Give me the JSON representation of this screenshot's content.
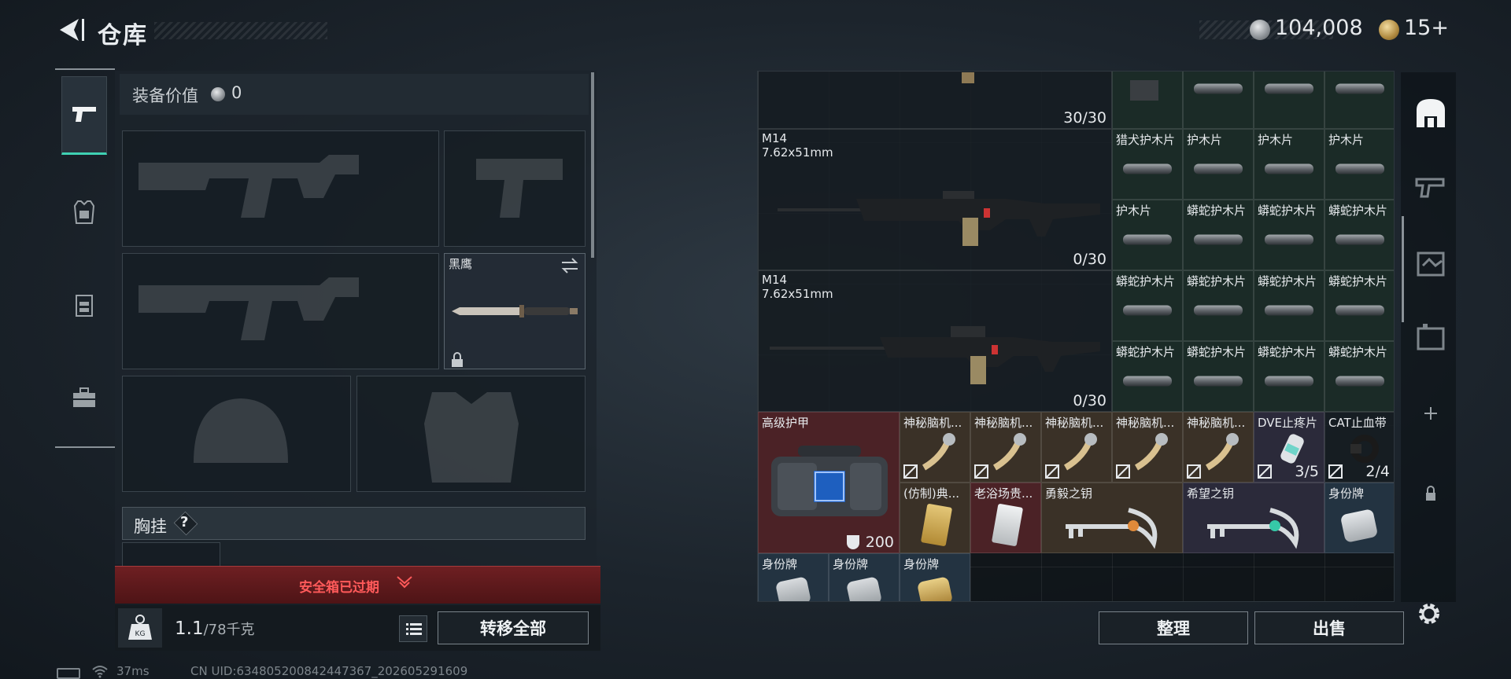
{
  "header": {
    "title": "仓库",
    "currency": "104,008",
    "tickets": "15+"
  },
  "left_tabs": [
    {
      "name": "weapons",
      "icon": "pistol-icon",
      "active": true
    },
    {
      "name": "armor",
      "icon": "armor-icon",
      "active": false
    },
    {
      "name": "rig",
      "icon": "chest-rig-icon",
      "active": false
    },
    {
      "name": "case",
      "icon": "toolbox-icon",
      "active": false
    }
  ],
  "equipment": {
    "value_label": "装备价值",
    "value": "0",
    "melee_name": "黑鹰",
    "chest_label": "胸挂",
    "chest_help": "?",
    "safebox_status": "安全箱已过期",
    "weight_current": "1.1",
    "weight_capacity": "/78千克",
    "transfer_all": "转移全部"
  },
  "status": {
    "ping": "37ms",
    "uid": "CN UID:6348052008424473​67_202605291609"
  },
  "stash": {
    "top_count": "30/30",
    "rifle1": {
      "name": "M14",
      "caliber": "7.62x51mm",
      "ammo": "0/30"
    },
    "rifle2": {
      "name": "M14",
      "caliber": "7.62x51mm",
      "ammo": "0/30"
    },
    "handguards": {
      "r1": [
        "猎犬护木片",
        "护木片",
        "护木片",
        "护木片"
      ],
      "r2": [
        "护木片",
        "蟒蛇护木片",
        "蟒蛇护木片",
        "蟒蛇护木片"
      ],
      "r3": [
        "蟒蛇护木片",
        "蟒蛇护木片",
        "蟒蛇护木片",
        "蟒蛇护木片"
      ],
      "r4": [
        "蟒蛇护木片",
        "蟒蛇护木片",
        "蟒蛇护木片",
        "蟒蛇护木片"
      ]
    },
    "armor": {
      "name": "高级护甲",
      "durability": "200"
    },
    "implants": [
      "神秘脑机...",
      "神秘脑机...",
      "神秘脑机...",
      "神秘脑机...",
      "神秘脑机..."
    ],
    "painkiller": {
      "name": "DVE止疼片",
      "count": "3/5"
    },
    "tourniquet": {
      "name": "CAT止血带",
      "count": "2/4"
    },
    "card1": "(仿制)典...",
    "card2": "老浴场贵...",
    "key1": "勇毅之钥",
    "key2": "希望之钥",
    "dogtags": [
      "身份牌",
      "身份牌",
      "身份牌",
      "身份牌"
    ]
  },
  "buttons": {
    "sort": "整理",
    "sell": "出售"
  },
  "colors": {
    "accent": "#3fd1b3",
    "alert_text": "#ff5a5a",
    "alert_bg": "#6e1f22",
    "rare_green": "#1b2b27",
    "rare_red": "#4b2226",
    "rare_gold": "#3a3127",
    "rare_purple": "#2b2a3a",
    "rare_blue": "#233341"
  }
}
